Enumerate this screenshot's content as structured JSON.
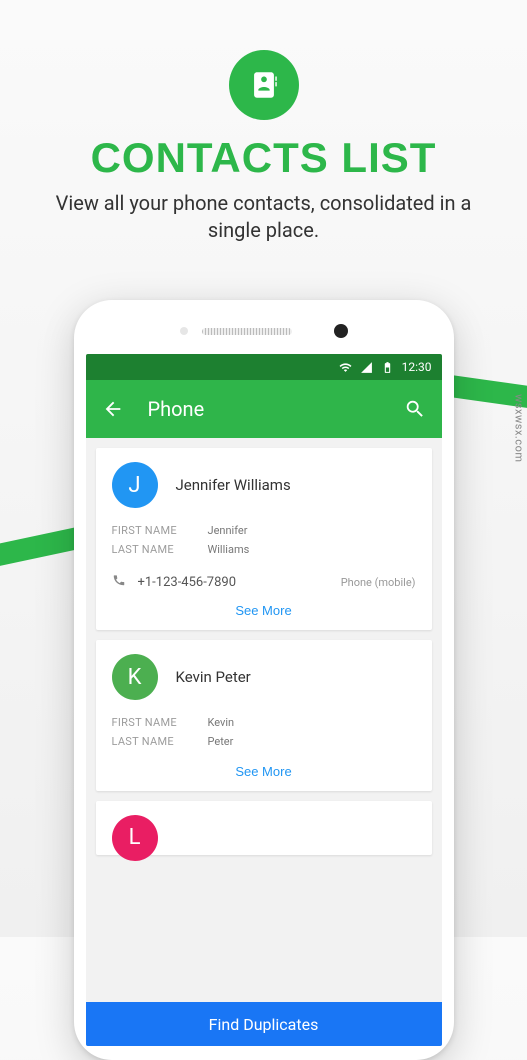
{
  "promo": {
    "title": "CONTACTS LIST",
    "subtitle": "View all your phone contacts, consolidated in a single place."
  },
  "watermark": "wsxwsx.com",
  "statusbar": {
    "time": "12:30"
  },
  "appbar": {
    "title": "Phone"
  },
  "labels": {
    "first_name": "FIRST NAME",
    "last_name": "LAST NAME",
    "see_more": "See More",
    "find_duplicates": "Find Duplicates"
  },
  "contacts": [
    {
      "initial": "J",
      "avatar_color": "blue",
      "name": "Jennifer Williams",
      "first_name": "Jennifer",
      "last_name": "Williams",
      "phone": "+1-123-456-7890",
      "phone_type": "Phone (mobile)"
    },
    {
      "initial": "K",
      "avatar_color": "green",
      "name": "Kevin Peter",
      "first_name": "Kevin",
      "last_name": "Peter"
    },
    {
      "initial": "L",
      "avatar_color": "pink",
      "name": ""
    }
  ]
}
